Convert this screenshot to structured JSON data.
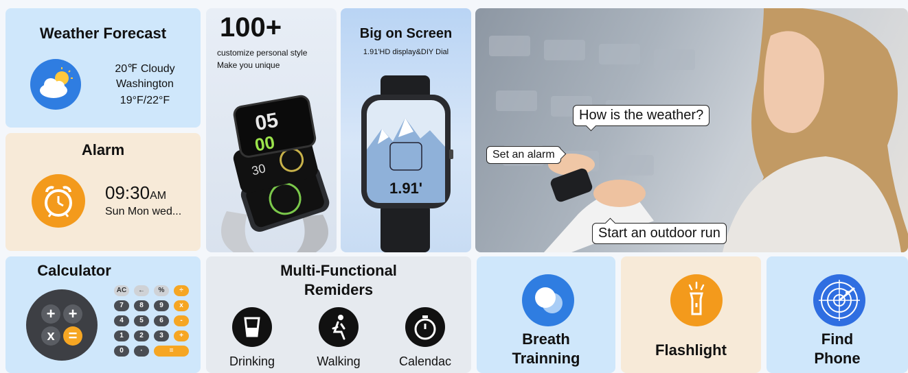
{
  "weather": {
    "title": "Weather Forecast",
    "condition": "20℉ Cloudy",
    "city": "Washington",
    "range": "19°F/22°F"
  },
  "alarm": {
    "title": "Alarm",
    "time": "09:30",
    "ampm": "AM",
    "days": "Sun Mon wed..."
  },
  "styles": {
    "headline": "100+",
    "line1": "customize personal style",
    "line2": "Make you unique"
  },
  "screen": {
    "title": "Big on Screen",
    "subtitle": "1.91'HD display&DIY Dial",
    "size_label": "1.91'"
  },
  "photo": {
    "bubble_weather": "How is the weather?",
    "bubble_alarm": "Set an alarm",
    "bubble_run": "Start an outdoor run"
  },
  "calculator": {
    "title": "Calculator",
    "keys": [
      [
        "AC",
        "←",
        "%",
        "÷"
      ],
      [
        "7",
        "8",
        "9",
        "x"
      ],
      [
        "4",
        "5",
        "6",
        "-"
      ],
      [
        "1",
        "2",
        "3",
        "+"
      ],
      [
        "0",
        "·",
        "="
      ]
    ],
    "big_keys": [
      "+",
      "+",
      "x",
      "="
    ]
  },
  "reminders": {
    "title_line1": "Multi-Functional",
    "title_line2": "Remiders",
    "items": [
      "Drinking",
      "Walking",
      "Calendac"
    ]
  },
  "breath": {
    "line1": "Breath",
    "line2": "Trainning"
  },
  "flashlight": {
    "label": "Flashlight"
  },
  "find_phone": {
    "line1": "Find",
    "line2": "Phone"
  },
  "colors": {
    "accent_blue": "#2f7de1",
    "accent_orange": "#f39a1c",
    "panel_blue": "#cfe7fb",
    "panel_cream": "#f7ead8"
  }
}
